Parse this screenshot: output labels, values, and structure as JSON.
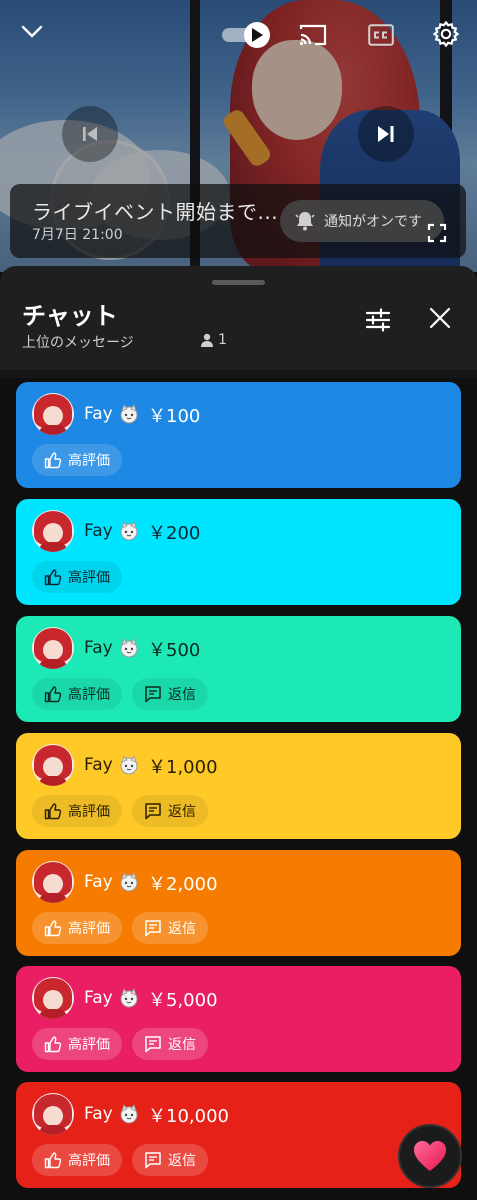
{
  "player": {
    "live_title": "ライブイベント開始まで...",
    "live_date": "7月7日 21:00",
    "notify_label": "通知がオンです"
  },
  "chat": {
    "title": "チャット",
    "subtitle": "上位のメッセージ",
    "viewer_count": "1"
  },
  "messages": [
    {
      "name": "Fay",
      "amount": "￥100",
      "like_label": "高評価",
      "reply_label": "",
      "bg": "#1e88e5",
      "fg": "#ffffff",
      "pill_bg": "rgba(255,255,255,0.14)",
      "pill_fg": "#ffffff"
    },
    {
      "name": "Fay",
      "amount": "￥200",
      "like_label": "高評価",
      "reply_label": "",
      "bg": "#00e5ff",
      "fg": "#0b2530",
      "pill_bg": "rgba(0,0,0,0.07)",
      "pill_fg": "#0b2530"
    },
    {
      "name": "Fay",
      "amount": "￥500",
      "like_label": "高評価",
      "reply_label": "返信",
      "bg": "#1de9b6",
      "fg": "#0b2b22",
      "pill_bg": "rgba(0,0,0,0.07)",
      "pill_fg": "#0b2b22"
    },
    {
      "name": "Fay",
      "amount": "￥1,000",
      "like_label": "高評価",
      "reply_label": "返信",
      "bg": "#ffca28",
      "fg": "#2b2000",
      "pill_bg": "rgba(0,0,0,0.07)",
      "pill_fg": "#2b2000"
    },
    {
      "name": "Fay",
      "amount": "￥2,000",
      "like_label": "高評価",
      "reply_label": "返信",
      "bg": "#f57c00",
      "fg": "#ffffff",
      "pill_bg": "rgba(255,255,255,0.18)",
      "pill_fg": "#ffffff"
    },
    {
      "name": "Fay",
      "amount": "￥5,000",
      "like_label": "高評価",
      "reply_label": "返信",
      "bg": "#e91e63",
      "fg": "#ffffff",
      "pill_bg": "rgba(255,255,255,0.18)",
      "pill_fg": "#ffffff"
    },
    {
      "name": "Fay",
      "amount": "￥10,000",
      "like_label": "高評価",
      "reply_label": "返信",
      "bg": "#e62117",
      "fg": "#ffffff",
      "pill_bg": "rgba(255,255,255,0.18)",
      "pill_fg": "#ffffff"
    }
  ]
}
